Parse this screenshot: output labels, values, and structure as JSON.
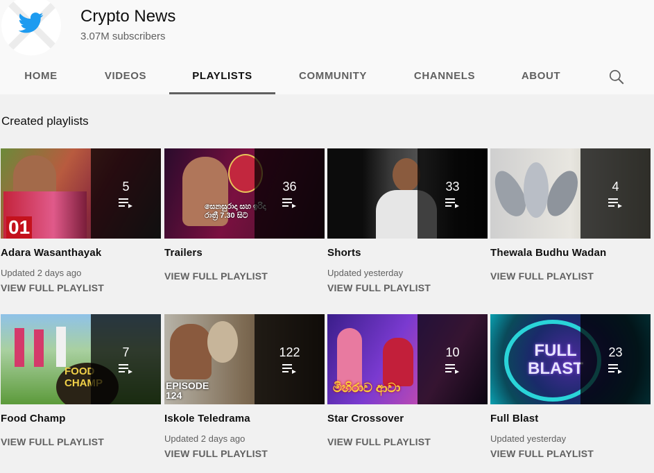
{
  "channel": {
    "name": "Crypto News",
    "subscribers": "3.07M subscribers"
  },
  "tabs": [
    {
      "label": "HOME",
      "active": false
    },
    {
      "label": "VIDEOS",
      "active": false
    },
    {
      "label": "PLAYLISTS",
      "active": true
    },
    {
      "label": "COMMUNITY",
      "active": false
    },
    {
      "label": "CHANNELS",
      "active": false
    },
    {
      "label": "ABOUT",
      "active": false
    }
  ],
  "section_title": "Created playlists",
  "view_full_label": "VIEW FULL PLAYLIST",
  "playlists": [
    {
      "title": "Adara Wasanthayak",
      "count": "5",
      "updated": "Updated 2 days ago",
      "thumb_text": "01"
    },
    {
      "title": "Trailers",
      "count": "36",
      "updated": "",
      "thumb_text": "සෙනසුරාදා සහ ඉරිදා රාත්‍රී 7.30 සිට"
    },
    {
      "title": "Shorts",
      "count": "33",
      "updated": "Updated yesterday",
      "thumb_text": ""
    },
    {
      "title": "Thewala Budhu Wadan",
      "count": "4",
      "updated": "",
      "thumb_text": ""
    },
    {
      "title": "Food Champ",
      "count": "7",
      "updated": "",
      "thumb_text": "FOOD CHAMP"
    },
    {
      "title": "Iskole Teledrama",
      "count": "122",
      "updated": "Updated 2 days ago",
      "thumb_text": "EPISODE 124"
    },
    {
      "title": "Star Crossover",
      "count": "10",
      "updated": "",
      "thumb_text": "මිහිරාව ආවා"
    },
    {
      "title": "Full Blast",
      "count": "23",
      "updated": "Updated yesterday",
      "thumb_text": "FULL BLAST"
    }
  ],
  "colors": {
    "background": "#f1f1f1",
    "header": "#f9f9f9",
    "twitter_blue": "#1d9bf0",
    "secondary_text": "#606060"
  },
  "icons": {
    "search": "search-icon",
    "playlist": "playlist-icon",
    "avatar": "twitter-bird-icon"
  }
}
